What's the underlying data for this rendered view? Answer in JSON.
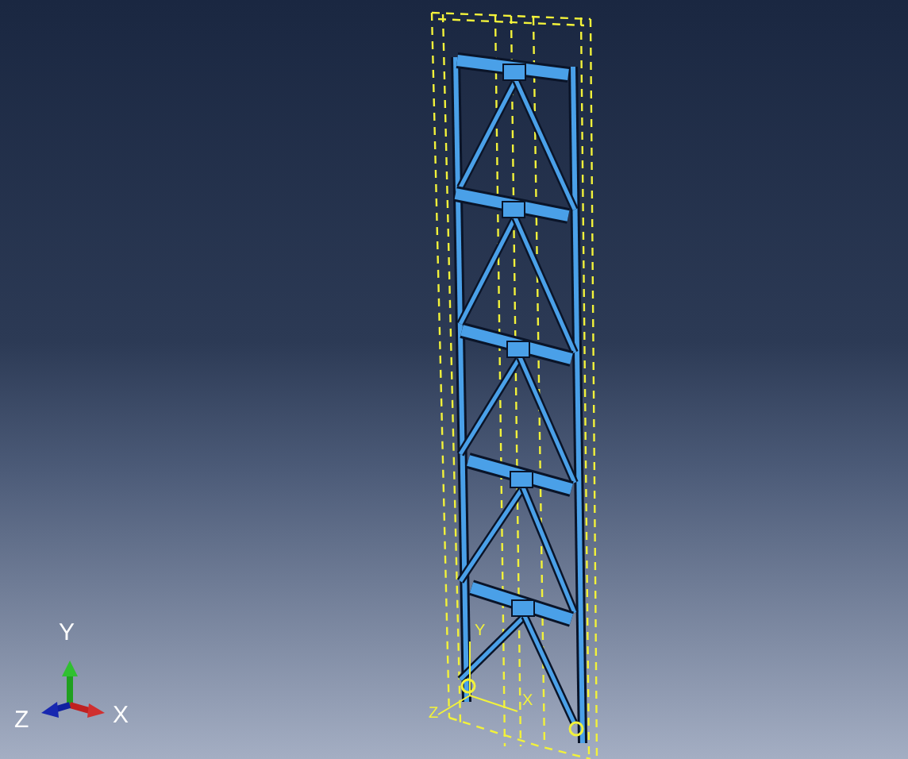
{
  "axis_triad": {
    "y": "Y",
    "z": "Z",
    "x": "X"
  },
  "local_csys": {
    "z": "Z",
    "y": "Y",
    "x": "X"
  }
}
